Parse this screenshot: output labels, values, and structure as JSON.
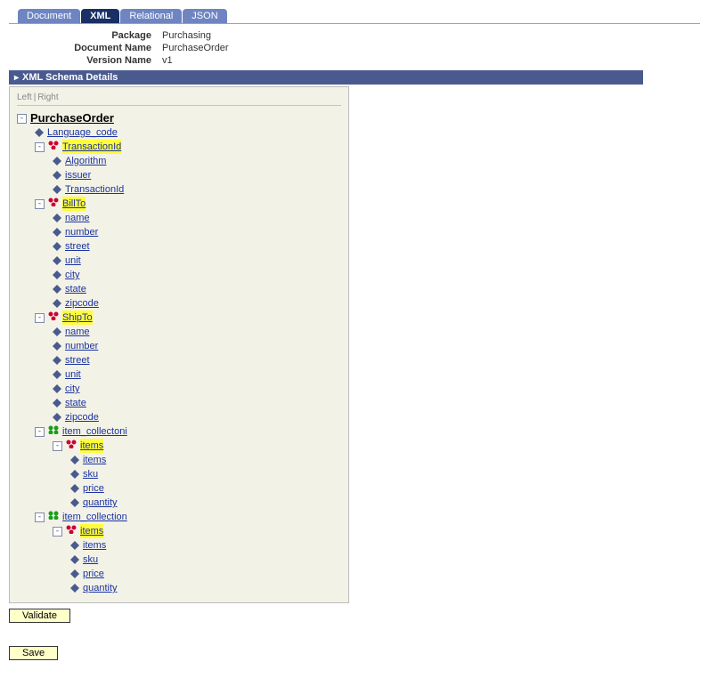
{
  "tabs": [
    "Document",
    "XML",
    "Relational",
    "JSON"
  ],
  "activeTab": 1,
  "meta": {
    "packageLabel": "Package",
    "packageVal": "Purchasing",
    "docLabel": "Document Name",
    "docVal": "PurchaseOrder",
    "verLabel": "Version Name",
    "verVal": "v1"
  },
  "sectionHeader": "XML Schema Details",
  "lr": {
    "left": "Left",
    "right": "Right"
  },
  "root": "PurchaseOrder",
  "nodes": {
    "language_code": "Language_code",
    "transactionId": "TransactionId",
    "algorithm": "Algorithm",
    "issuer": "issuer",
    "transactionId2": "TransactionId",
    "billto": "BillTo",
    "name": "name",
    "number": "number",
    "street": "street",
    "unit": "unit",
    "city": "city",
    "state": "state",
    "zipcode": "zipcode",
    "shipto": "ShipTo",
    "item_collectoni": "item_collectoni",
    "items": "items",
    "sku": "sku",
    "price": "price",
    "quantity": "quantity",
    "item_collection": "item_collection"
  },
  "buttons": {
    "validate": "Validate",
    "save": "Save"
  }
}
